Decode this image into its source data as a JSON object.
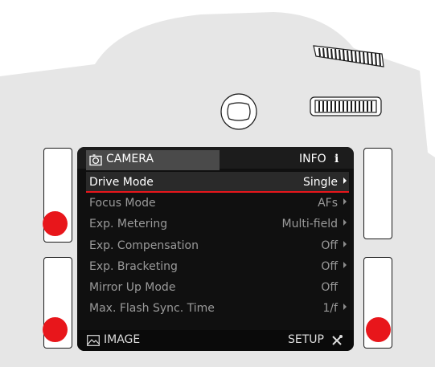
{
  "screen": {
    "header": {
      "title": "CAMERA",
      "info_label": "INFO",
      "info_glyph": "i",
      "camera_icon": "camera-icon"
    },
    "menu_items": [
      {
        "label": "Drive Mode",
        "value": "Single",
        "selected": true,
        "has_submenu": true
      },
      {
        "label": "Focus Mode",
        "value": "AFs",
        "selected": false,
        "has_submenu": true
      },
      {
        "label": "Exp. Metering",
        "value": "Multi-field",
        "selected": false,
        "has_submenu": true
      },
      {
        "label": "Exp. Compensation",
        "value": "Off",
        "selected": false,
        "has_submenu": true
      },
      {
        "label": "Exp. Bracketing",
        "value": "Off",
        "selected": false,
        "has_submenu": true
      },
      {
        "label": "Mirror Up Mode",
        "value": "Off",
        "selected": false,
        "has_submenu": false
      },
      {
        "label": "Max. Flash Sync. Time",
        "value": "1/f",
        "selected": false,
        "has_submenu": true
      }
    ],
    "footer": {
      "left_label": "IMAGE",
      "left_icon": "image-icon",
      "right_label": "SETUP",
      "right_icon": "tools-icon"
    }
  },
  "colors": {
    "body": "#e6e6e6",
    "screen": "#101010",
    "accent_red": "#e8161b",
    "selected_row": "#2a2a2a"
  }
}
